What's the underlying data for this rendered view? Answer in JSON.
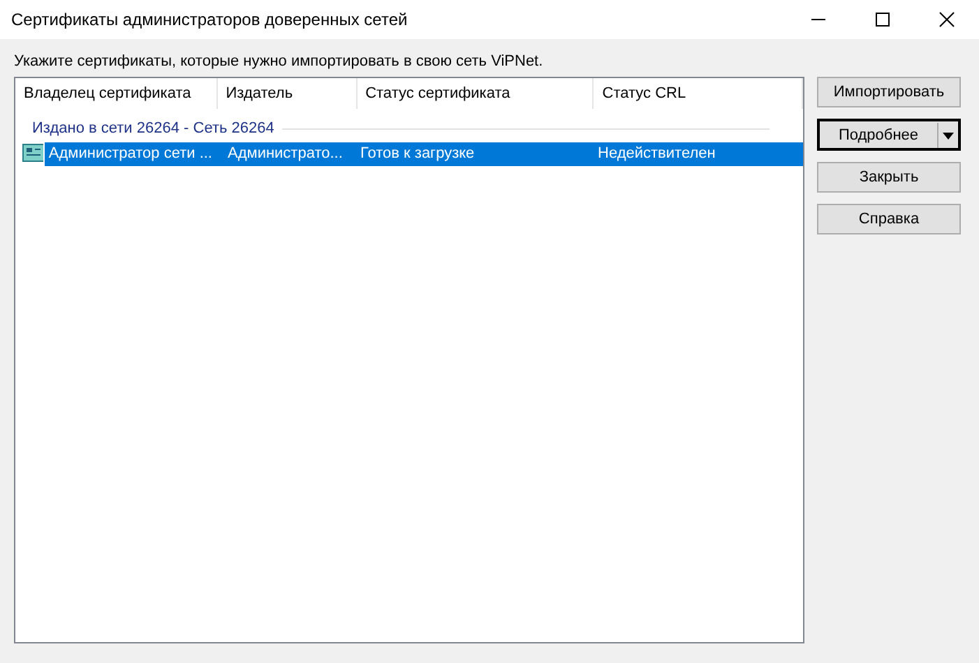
{
  "window": {
    "title": "Сертификаты администраторов доверенных сетей"
  },
  "instruction": "Укажите сертификаты, которые нужно импортировать в свою сеть ViPNet.",
  "table": {
    "columns": [
      "Владелец сертификата",
      "Издатель",
      "Статус сертификата",
      "Статус CRL"
    ],
    "groups": [
      {
        "label": "Издано в сети 26264 - Сеть 26264",
        "rows": [
          {
            "cells": [
              "Администратор сети ...",
              "Администрато...",
              "Готов к загрузке",
              "Недействителен"
            ],
            "selected": true
          }
        ]
      }
    ]
  },
  "buttons": [
    {
      "label": "Импортировать",
      "kind": "plain",
      "default": false
    },
    {
      "label": "Подробнее",
      "kind": "split",
      "default": true
    },
    {
      "label": "Закрыть",
      "kind": "plain",
      "default": false
    },
    {
      "label": "Справка",
      "kind": "plain",
      "default": false
    }
  ]
}
